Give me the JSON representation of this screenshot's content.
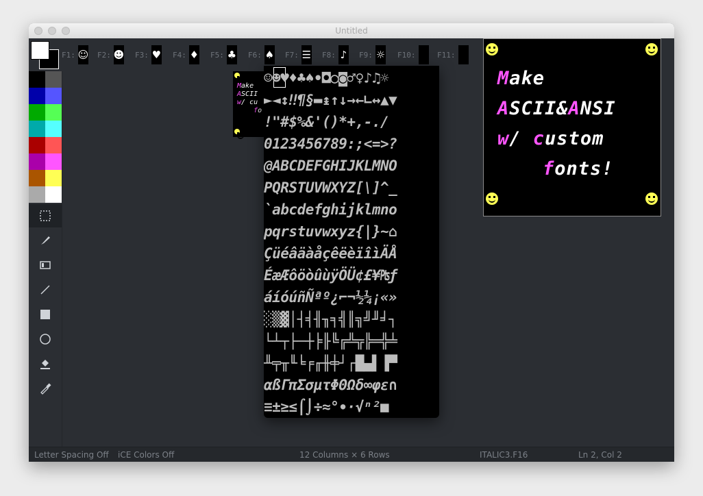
{
  "window": {
    "title": "Untitled"
  },
  "fkeys": [
    {
      "label": "F1:",
      "glyph": "☺"
    },
    {
      "label": "F2:",
      "glyph": "☻"
    },
    {
      "label": "F3:",
      "glyph": "♥"
    },
    {
      "label": "F4:",
      "glyph": "♦"
    },
    {
      "label": "F5:",
      "glyph": "♣"
    },
    {
      "label": "F6:",
      "glyph": "♠"
    },
    {
      "label": "F7:",
      "glyph": "☰"
    },
    {
      "label": "F8:",
      "glyph": "♪"
    },
    {
      "label": "F9:",
      "glyph": "☼"
    },
    {
      "label": "F10:",
      "glyph": ""
    },
    {
      "label": "F11:",
      "glyph": ""
    }
  ],
  "palette": [
    "#000000",
    "#555555",
    "#0000aa",
    "#5555ff",
    "#00aa00",
    "#55ff55",
    "#00aaaa",
    "#55ffff",
    "#aa0000",
    "#ff5555",
    "#aa00aa",
    "#ff55ff",
    "#aa5500",
    "#ffff55",
    "#aaaaaa",
    "#ffffff"
  ],
  "tools": [
    "selection-icon",
    "brush-icon",
    "half-block-icon",
    "line-icon",
    "rectangle-icon",
    "ellipse-icon",
    "fill-icon",
    "eyedropper-icon"
  ],
  "charset_rows": [
    " ☺☻♥♦♣♠•◘○◙♂♀♪♫☼",
    "►◄↕‼¶§▬↨↑↓→←∟↔▲▼",
    " !\"#$%&'()*+,-./",
    "0123456789:;<=>?",
    "@ABCDEFGHIJKLMNO",
    "PQRSTUVWXYZ[\\]^_",
    "`abcdefghijklmno",
    "pqrstuvwxyz{|}~⌂",
    "ÇüéâäàåçêëèïîìÄÅ",
    "ÉæÆôöòûùÿÖÜ¢£¥₧ƒ",
    "áíóúñÑªº¿⌐¬½¼¡«»",
    "░▒▓│┤╡╢╖╕╣║╗╝╜╛┐",
    "└┴┬├─┼╞╟╚╔╩╦╠═╬╧",
    "╨╤╥╙╘╒╓╫╪┘┌█▄▌▐▀",
    "αßΓπΣσµτΦΘΩδ∞φε∩",
    "≡±≥≤⌠⌡÷≈°∙·√ⁿ²■ "
  ],
  "preview": {
    "lines": [
      {
        "first": "M",
        "rest": "ake"
      },
      {
        "first": "A",
        "rest": "SCII&",
        "first2": "A",
        "rest2": "NSI"
      },
      {
        "first": "w",
        "rest": "/ ",
        "first2": "c",
        "rest2": "ustom"
      },
      {
        "first": "f",
        "rest": "onts!"
      }
    ]
  },
  "status": {
    "letter_spacing": "Letter Spacing Off",
    "ice_colors": "iCE Colors Off",
    "font_grid": "12 Columns × 6 Rows",
    "font_name": "ITALIC3.F16",
    "position": "Ln 2, Col 2"
  }
}
